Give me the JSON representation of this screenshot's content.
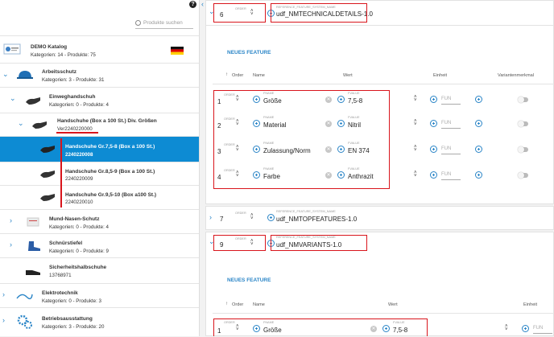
{
  "left": {
    "search_placeholder": "Produkte suchen",
    "help": "?",
    "catalog": {
      "title": "DEMO Katalog",
      "sub": "Kategorien: 14 - Produkte: 75"
    },
    "nodes": [
      {
        "title": "Arbeitsschutz",
        "sub": "Kategorien: 3 - Produkte: 31"
      },
      {
        "title": "Einweghandschuh",
        "sub": "Kategorien: 0 - Produkte: 4"
      },
      {
        "title": "Handschuhe (Box a 100 St.) Div. Größen",
        "sub": "Ver2240220000"
      },
      {
        "title": "Handschuhe Gr.7,5-8 (Box a 100 St.)",
        "sub": "2240220008"
      },
      {
        "title": "Handschuhe Gr.8,5-9 (Box a 100 St.)",
        "sub": "2240220009"
      },
      {
        "title": "Handschuhe Gr.9,5-10 (Box a100 St.)",
        "sub": "2240220010"
      },
      {
        "title": "Mund-Nasen-Schutz",
        "sub": "Kategorien: 0 - Produkte: 4"
      },
      {
        "title": "Schnürstiefel",
        "sub": "Kategorien: 0 - Produkte: 9"
      },
      {
        "title": "Sicherheitshalbschuhe",
        "sub": "13768971"
      },
      {
        "title": "Elektrotechnik",
        "sub": "Kategorien: 0 - Produkte: 3"
      },
      {
        "title": "Betriebsausstattung",
        "sub": "Kategorien: 3 - Produkte: 20"
      }
    ]
  },
  "right": {
    "group1": {
      "order": "6",
      "order_label": "ORDER",
      "ref_label": "REFERENCE_FEATURE_SYSTEM_NAME",
      "ref_value": "udf_NMTECHNICALDETAILS-1.0"
    },
    "new_feature": "NEUES FEATURE",
    "headers": {
      "order": "Order",
      "name": "Name",
      "wert": "Wert",
      "einheit": "Einheit",
      "variant": "Variantenmerkmal"
    },
    "features": [
      {
        "order": "1",
        "fname": "Größe",
        "fvalue": "7,5-8"
      },
      {
        "order": "2",
        "fname": "Material",
        "fvalue": "Nitril"
      },
      {
        "order": "3",
        "fname": "Zulassung/Norm",
        "fvalue": "EN 374"
      },
      {
        "order": "4",
        "fname": "Farbe",
        "fvalue": "Anthrazit"
      }
    ],
    "field_labels": {
      "order": "ORDER",
      "fname": "FNAME",
      "fvalue": "FVALUE",
      "funit": "FUN"
    },
    "group2": {
      "order": "7",
      "order_label": "ORDER",
      "ref_label": "REFERENCE_FEATURE_SYSTEM_NAME",
      "ref_value": "udf_NMTOPFEATURES-1.0"
    },
    "group3": {
      "order": "9",
      "order_label": "ORDER",
      "ref_label": "REFERENCE_FEATURE_SYSTEM_NAME",
      "ref_value": "udf_NMVARIANTS-1.0"
    },
    "new_feature2": "NEUES FEATURE",
    "headers2": {
      "order": "Order",
      "name": "Name",
      "wert": "Wert",
      "einheit": "Einheit"
    },
    "feature2": {
      "order": "1",
      "fname": "Größe",
      "fvalue": "7,5-8"
    }
  },
  "colors": {
    "accent": "#0d8bd3",
    "highlight": "#d9151c"
  }
}
